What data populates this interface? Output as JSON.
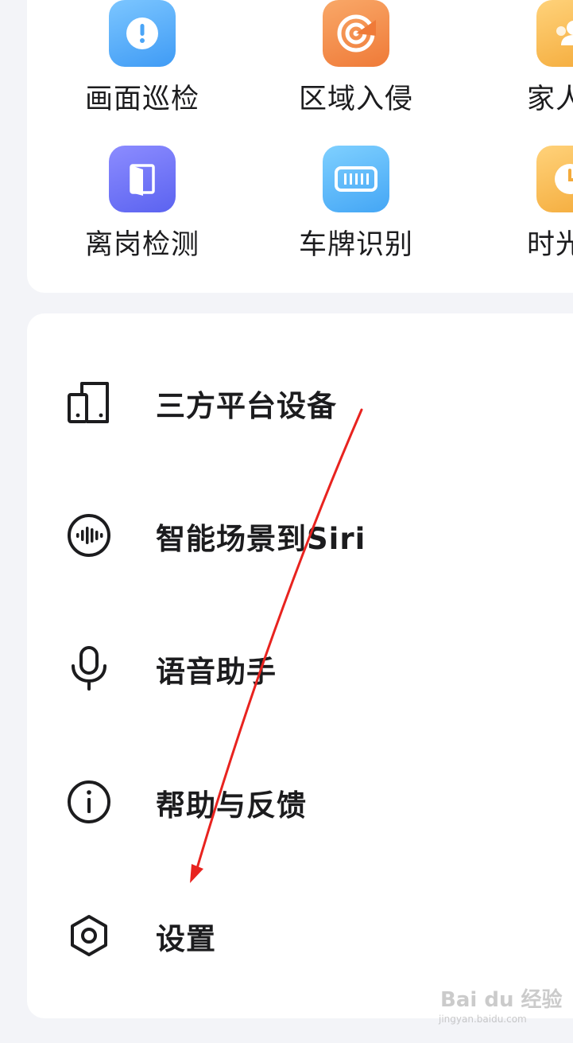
{
  "features": {
    "row1": [
      {
        "label": "画面巡检",
        "icon": "alert-icon",
        "color": "#4aa5f7"
      },
      {
        "label": "区域入侵",
        "icon": "radar-target-icon",
        "color": "#f0843f"
      },
      {
        "label": "家人守",
        "icon": "family-icon",
        "color": "#f5b545"
      }
    ],
    "row2": [
      {
        "label": "离岗检测",
        "icon": "door-exit-icon",
        "color": "#636af2"
      },
      {
        "label": "车牌识别",
        "icon": "license-plate-icon",
        "color": "#4ba9f5"
      },
      {
        "label": "时光缩",
        "icon": "clock-icon",
        "color": "#f5b545"
      }
    ]
  },
  "menu": {
    "items": [
      {
        "label": "三方平台设备",
        "icon": "devices-icon"
      },
      {
        "label": "智能场景到Siri",
        "icon": "voice-wave-icon"
      },
      {
        "label": "语音助手",
        "icon": "microphone-icon"
      },
      {
        "label": "帮助与反馈",
        "icon": "info-icon"
      },
      {
        "label": "设置",
        "icon": "settings-hexagon-icon"
      }
    ]
  },
  "annotation": {
    "type": "red-arrow",
    "color": "#e8231f"
  },
  "watermark": {
    "main": "Bai du 经验",
    "sub": "jingyan.baidu.com"
  }
}
